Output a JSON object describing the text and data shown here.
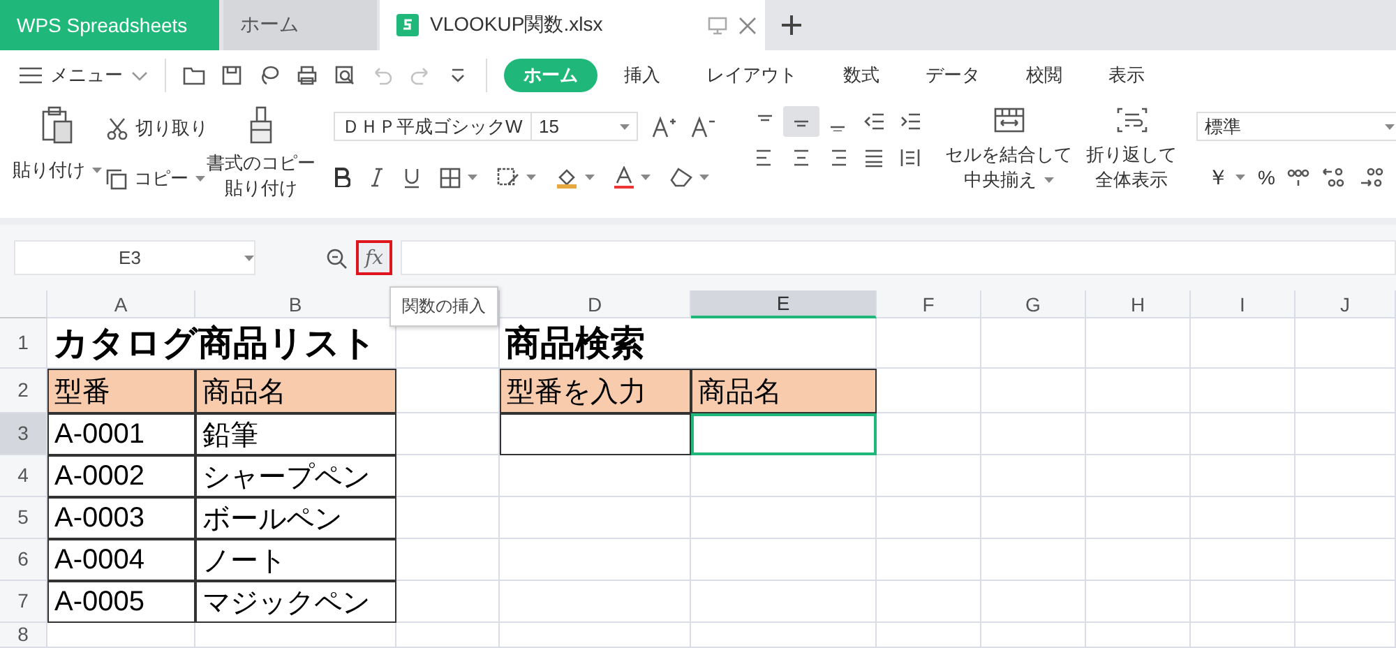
{
  "tabs": [
    {
      "label": "WPS Spreadsheets",
      "kind": "app",
      "selected": false
    },
    {
      "label": "ホーム",
      "kind": "home",
      "selected": false
    },
    {
      "label": "VLOOKUP関数.xlsx",
      "kind": "file",
      "selected": true
    }
  ],
  "menu": {
    "label": "メニュー"
  },
  "quick_access": {
    "undo": {
      "disabled": true
    },
    "redo": {
      "disabled": true
    }
  },
  "ribbon_tabs": [
    {
      "label": "ホーム",
      "selected": true
    },
    {
      "label": "挿入",
      "selected": false
    },
    {
      "label": "レイアウト",
      "selected": false
    },
    {
      "label": "数式",
      "selected": false
    },
    {
      "label": "データ",
      "selected": false
    },
    {
      "label": "校閲",
      "selected": false
    },
    {
      "label": "表示",
      "selected": false
    }
  ],
  "ribbon": {
    "paste": {
      "label": "貼り付け"
    },
    "cut": {
      "label": "切り取り"
    },
    "copy": {
      "label": "コピー"
    },
    "format_painter": {
      "lines": [
        "書式のコピー",
        "貼り付け"
      ]
    },
    "font_name": "ＤＨＰ平成ゴシックW",
    "font_size": "15",
    "vertical_align": [
      {
        "selected": false
      },
      {
        "selected": true
      },
      {
        "selected": false
      }
    ],
    "merge": {
      "lines": [
        "セルを結合して",
        "中央揃え"
      ]
    },
    "wrap": {
      "lines": [
        "折り返して",
        "全体表示"
      ]
    },
    "number_format": "標準",
    "currency": "￥",
    "percent": "%"
  },
  "formula_bar": {
    "name_box": "E3",
    "function_button": "fx",
    "tooltip": "関数の挿入"
  },
  "sheet": {
    "columns": [
      {
        "label": "A",
        "selected": false
      },
      {
        "label": "B",
        "selected": false
      },
      {
        "selected": false
      },
      {
        "label": "D",
        "selected": false
      },
      {
        "label": "E",
        "selected": true
      },
      {
        "label": "F",
        "selected": false
      },
      {
        "label": "G",
        "selected": false
      },
      {
        "label": "H",
        "selected": false
      },
      {
        "label": "I",
        "selected": false
      },
      {
        "label": "J",
        "selected": false
      }
    ],
    "rows": [
      {
        "label": "1",
        "selected": false,
        "cells": [
          {
            "text": "カタログ商品リスト",
            "kind": "title"
          },
          null,
          null,
          {
            "text": "商品検索",
            "kind": "title"
          },
          null,
          null,
          null,
          null,
          null,
          null
        ]
      },
      {
        "label": "2",
        "selected": false,
        "cells": [
          {
            "text": "型番",
            "kind": "header"
          },
          {
            "text": "商品名",
            "kind": "header"
          },
          null,
          {
            "text": "型番を入力",
            "kind": "header"
          },
          {
            "text": "商品名",
            "kind": "header"
          },
          null,
          null,
          null,
          null,
          null
        ]
      },
      {
        "label": "3",
        "selected": true,
        "cells": [
          {
            "text": "A-0001",
            "kind": "data"
          },
          {
            "text": "鉛筆",
            "kind": "data"
          },
          null,
          {
            "kind": "data"
          },
          {
            "kind": "data",
            "selected": true
          },
          null,
          null,
          null,
          null,
          null
        ]
      },
      {
        "label": "4",
        "selected": false,
        "cells": [
          {
            "text": "A-0002",
            "kind": "data"
          },
          {
            "text": "シャープペン",
            "kind": "data"
          },
          null,
          null,
          null,
          null,
          null,
          null,
          null,
          null
        ]
      },
      {
        "label": "5",
        "selected": false,
        "cells": [
          {
            "text": "A-0003",
            "kind": "data"
          },
          {
            "text": "ボールペン",
            "kind": "data"
          },
          null,
          null,
          null,
          null,
          null,
          null,
          null,
          null
        ]
      },
      {
        "label": "6",
        "selected": false,
        "cells": [
          {
            "text": "A-0004",
            "kind": "data"
          },
          {
            "text": "ノート",
            "kind": "data"
          },
          null,
          null,
          null,
          null,
          null,
          null,
          null,
          null
        ]
      },
      {
        "label": "7",
        "selected": false,
        "cells": [
          {
            "text": "A-0005",
            "kind": "data"
          },
          {
            "text": "マジックペン",
            "kind": "data"
          },
          null,
          null,
          null,
          null,
          null,
          null,
          null,
          null
        ]
      },
      {
        "label": "8",
        "selected": false,
        "cells": [
          null,
          null,
          null,
          null,
          null,
          null,
          null,
          null,
          null,
          null
        ]
      }
    ]
  }
}
